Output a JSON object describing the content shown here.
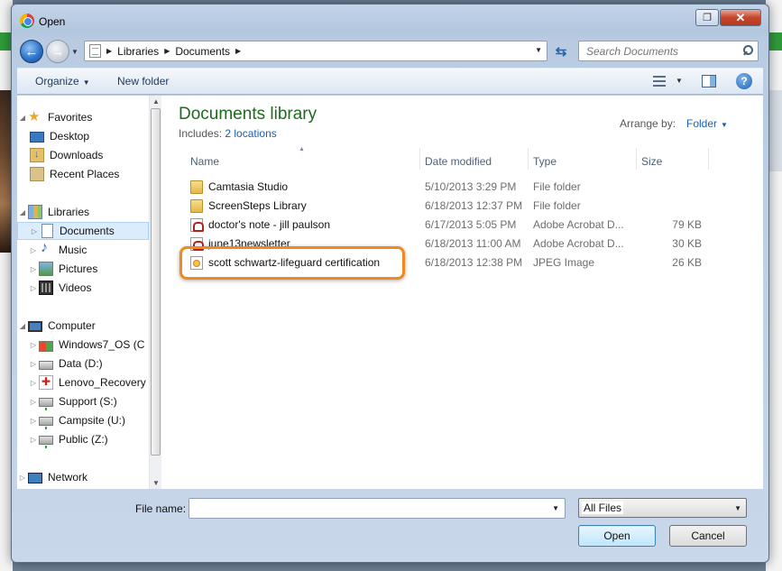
{
  "window": {
    "title": "Open"
  },
  "address": {
    "crumbs": [
      "Libraries",
      "Documents"
    ],
    "search_placeholder": "Search Documents"
  },
  "toolbar": {
    "organize_label": "Organize",
    "new_folder_label": "New folder"
  },
  "nav": {
    "favorites": "Favorites",
    "desktop": "Desktop",
    "downloads": "Downloads",
    "recent_places": "Recent Places",
    "libraries": "Libraries",
    "documents": "Documents",
    "music": "Music",
    "pictures": "Pictures",
    "videos": "Videos",
    "computer": "Computer",
    "drive_c": "Windows7_OS (C",
    "drive_d": "Data (D:)",
    "drive_recovery": "Lenovo_Recovery",
    "drive_s": "Support (S:)",
    "drive_u": "Campsite (U:)",
    "drive_z": "Public (Z:)",
    "network": "Network"
  },
  "library": {
    "title": "Documents library",
    "includes_prefix": "Includes:",
    "includes_link": "2 locations",
    "arrange_label": "Arrange by:",
    "arrange_value": "Folder"
  },
  "columns": {
    "name": "Name",
    "date": "Date modified",
    "type": "Type",
    "size": "Size"
  },
  "files": [
    {
      "name": "Camtasia Studio",
      "date": "5/10/2013 3:29 PM",
      "type": "File folder",
      "size": "",
      "icon": "folder-icon"
    },
    {
      "name": "ScreenSteps Library",
      "date": "6/18/2013 12:37 PM",
      "type": "File folder",
      "size": "",
      "icon": "folder-icon"
    },
    {
      "name": "doctor's note - jill paulson",
      "date": "6/17/2013 5:05 PM",
      "type": "Adobe Acrobat D...",
      "size": "79 KB",
      "icon": "pdf-icon"
    },
    {
      "name": "june13newsletter",
      "date": "6/18/2013 11:00 AM",
      "type": "Adobe Acrobat D...",
      "size": "30 KB",
      "icon": "pdf-icon"
    },
    {
      "name": "scott schwartz-lifeguard certification",
      "date": "6/18/2013 12:38 PM",
      "type": "JPEG Image",
      "size": "26 KB",
      "icon": "jpeg-icon"
    }
  ],
  "bottom": {
    "file_name_label": "File name:",
    "file_name_value": "",
    "filter_value": "All Files",
    "open_label": "Open",
    "cancel_label": "Cancel"
  },
  "colors": {
    "library_title": "#1e6b1e",
    "link": "#1a5fb4",
    "highlight": "#f08a1f",
    "selected_row": "#dbecfc"
  }
}
